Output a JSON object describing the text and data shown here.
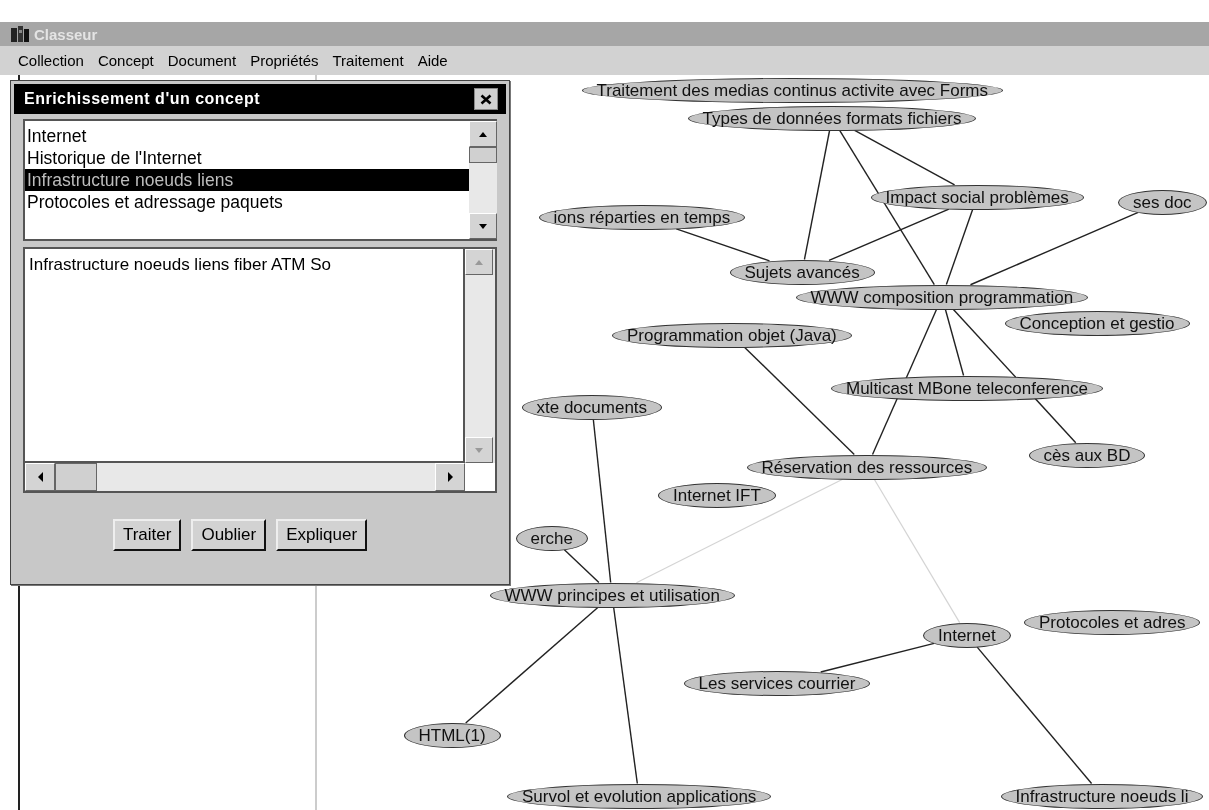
{
  "window": {
    "title": "Classeur"
  },
  "menu": [
    "Collection",
    "Concept",
    "Document",
    "Propriétés",
    "Traitement",
    "Aide"
  ],
  "dialog": {
    "title": "Enrichissement d'un concept",
    "list": [
      {
        "label": "Internet",
        "selected": false
      },
      {
        "label": "Historique de l'Internet",
        "selected": false
      },
      {
        "label": "Infrastructure noeuds liens",
        "selected": true
      },
      {
        "label": "Protocoles et adressage paquets",
        "selected": false
      }
    ],
    "text": "Infrastructure noeuds liens fiber ATM So",
    "buttons": [
      "Traiter",
      "Oublier",
      "Expliquer"
    ]
  },
  "graph": {
    "nodes": [
      {
        "label": "Traitement des medias continus activite avec Forms"
      },
      {
        "label": "Types de données formats fichiers"
      },
      {
        "label": "Impact social problèmes"
      },
      {
        "label": "ses doc"
      },
      {
        "label": "ions réparties en temps"
      },
      {
        "label": "Sujets avancés"
      },
      {
        "label": "WWW composition programmation"
      },
      {
        "label": "Conception et gestio"
      },
      {
        "label": "Programmation objet (Java)"
      },
      {
        "label": "Multicast MBone teleconference"
      },
      {
        "label": "xte documents"
      },
      {
        "label": "Réservation des ressources"
      },
      {
        "label": "cès aux BD"
      },
      {
        "label": "Internet IFT"
      },
      {
        "label": "erche"
      },
      {
        "label": "WWW principes et utilisation"
      },
      {
        "label": "Internet"
      },
      {
        "label": "Protocoles et adres"
      },
      {
        "label": "Les services courrier"
      },
      {
        "label": "HTML(1)"
      },
      {
        "label": "Survol et evolution applications"
      },
      {
        "label": "Infrastructure noeuds li"
      }
    ]
  }
}
